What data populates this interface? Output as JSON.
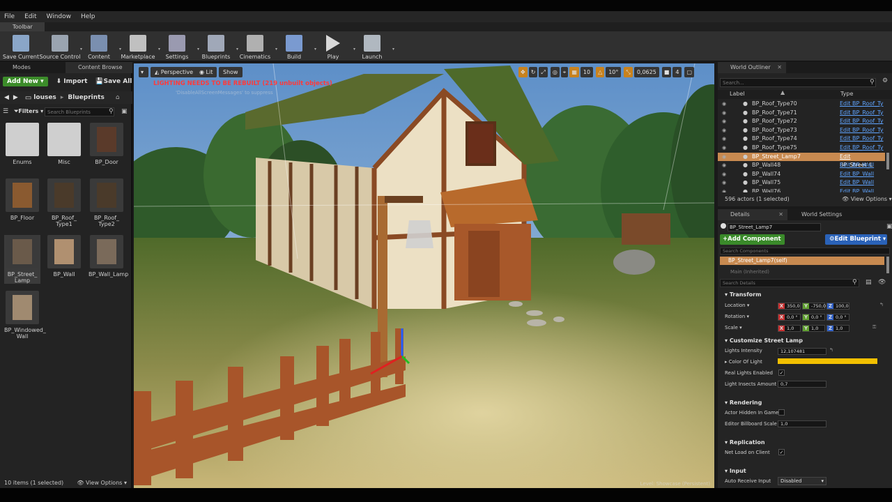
{
  "menu": [
    "File",
    "Edit",
    "Window",
    "Help"
  ],
  "toolbar_tab": "Toolbar",
  "toolbar": [
    {
      "label": "Save Current",
      "icon": "save-icon",
      "color": "#8aa6c8"
    },
    {
      "label": "Source Control",
      "icon": "source-control-icon",
      "color": "#9aa4b0"
    },
    {
      "label": "Content",
      "icon": "content-icon",
      "color": "#7a8fb0"
    },
    {
      "label": "Marketplace",
      "icon": "marketplace-icon",
      "color": "#c0c0c0"
    },
    {
      "label": "Settings",
      "icon": "settings-icon",
      "color": "#9a9ab0"
    },
    {
      "label": "Blueprints",
      "icon": "blueprints-icon",
      "color": "#a0a8b8"
    },
    {
      "label": "Cinematics",
      "icon": "cinematics-icon",
      "color": "#b0b0b0"
    },
    {
      "label": "Build",
      "icon": "build-icon",
      "color": "#7a9ad0"
    },
    {
      "label": "Play",
      "icon": "play-icon",
      "color": "#d8d8d8"
    },
    {
      "label": "Launch",
      "icon": "launch-icon",
      "color": "#b0b8c0"
    }
  ],
  "left": {
    "tab_modes": "Modes",
    "tab_content": "Content Browse",
    "add_new": "Add New",
    "import": "Import",
    "save_all": "Save All",
    "path_parent": "louses",
    "path_current": "Blueprints",
    "filters": "Filters",
    "search_placeholder": "Search Blueprints",
    "assets": [
      "Enums",
      "Misc",
      "BP_Door",
      "BP_Floor",
      "BP_Roof_ Type1",
      "BP_Roof_ Type2",
      "BP_Street_ Lamp",
      "BP_Wall",
      "BP_Wall_Lamp",
      "BP_Windowed_ Wall"
    ],
    "status": "10 items (1 selected)",
    "view_options": "View Options"
  },
  "viewport": {
    "perspective": "Perspective",
    "lit": "Lit",
    "show": "Show",
    "warning": "LIGHTING NEEDS TO BE REBUILT (219 unbuilt objects)",
    "sub_warning": "'DisableAllScreenMessages' to suppress",
    "grid": "10",
    "angle": "10°",
    "scale": "0,0625",
    "cam": "4",
    "level": "Level: Showcase (Persistent)"
  },
  "outliner": {
    "tab": "World Outliner",
    "search_placeholder": "Search...",
    "col_label": "Label",
    "col_type": "Type",
    "rows": [
      {
        "label": "BP_Roof_Type70",
        "type": "Edit BP_Roof_Ty"
      },
      {
        "label": "BP_Roof_Type71",
        "type": "Edit BP_Roof_Ty"
      },
      {
        "label": "BP_Roof_Type72",
        "type": "Edit BP_Roof_Ty"
      },
      {
        "label": "BP_Roof_Type73",
        "type": "Edit BP_Roof_Ty"
      },
      {
        "label": "BP_Roof_Type74",
        "type": "Edit BP_Roof_Ty"
      },
      {
        "label": "BP_Roof_Type75",
        "type": "Edit BP_Roof_Ty"
      },
      {
        "label": "BP_Street_Lamp7",
        "type": "Edit BP_Street_L"
      },
      {
        "label": "BP_Wall48",
        "type": "Edit BP_Wall"
      },
      {
        "label": "BP_Wall74",
        "type": "Edit BP_Wall"
      },
      {
        "label": "BP_Wall75",
        "type": "Edit BP_Wall"
      },
      {
        "label": "BP_Wall76",
        "type": "Edit BP_Wall"
      }
    ],
    "status": "596 actors (1 selected)",
    "view_options": "View Options"
  },
  "details": {
    "tab_details": "Details",
    "tab_world": "World Settings",
    "name": "BP_Street_Lamp7",
    "add_component": "Add Component",
    "edit_blueprint": "Edit Blueprint",
    "search_components": "Search Components",
    "self_item": "BP_Street_Lamp7(self)",
    "main_inherited": "Main (Inherited)",
    "search_details": "Search Details",
    "transform": "Transform",
    "location": "Location",
    "rotation": "Rotation",
    "scale": "Scale",
    "loc": [
      "350,0",
      "-750,0",
      "100,0"
    ],
    "rot": [
      "0,0 °",
      "0,0 °",
      "0,0 °"
    ],
    "scl": [
      "1,0",
      "1,0",
      "1,0"
    ],
    "customize": "Customize Street Lamp",
    "lights_intensity": "Lights Intensity",
    "lights_intensity_val": "12,107481",
    "color_of_light": "Color Of Light",
    "light_color": "#f2c000",
    "real_lights": "Real Lights Enabled",
    "insects": "Light Insects Amount",
    "insects_val": "0,7",
    "rendering": "Rendering",
    "hidden": "Actor Hidden In Game",
    "billboard": "Editor Billboard Scale",
    "billboard_val": "1,0",
    "replication": "Replication",
    "net_load": "Net Load on Client",
    "input": "Input",
    "auto_receive": "Auto Receive Input",
    "auto_receive_val": "Disabled"
  }
}
